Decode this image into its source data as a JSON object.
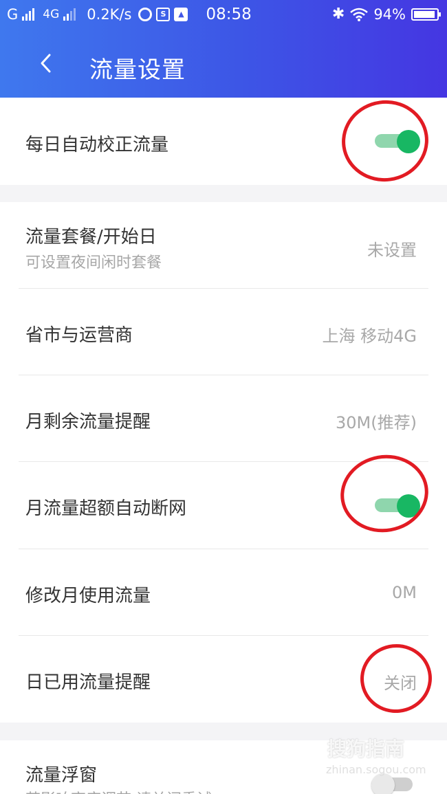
{
  "status_bar": {
    "carrier_g": "G",
    "network": "4G",
    "speed": "0.2K/s",
    "time": "08:58",
    "battery": "94%"
  },
  "header": {
    "title": "流量设置"
  },
  "settings": {
    "auto_calibrate": {
      "label": "每日自动校正流量",
      "enabled": true
    },
    "plan": {
      "label": "流量套餐/开始日",
      "sub": "可设置夜间闲时套餐",
      "value": "未设置"
    },
    "region": {
      "label": "省市与运营商",
      "value": "上海 移动4G"
    },
    "remaining_alert": {
      "label": "月剩余流量提醒",
      "value": "30M(推荐)"
    },
    "auto_disconnect": {
      "label": "月流量超额自动断网",
      "enabled": true
    },
    "monthly_usage": {
      "label": "修改月使用流量",
      "value": "0M"
    },
    "daily_alert": {
      "label": "日已用流量提醒",
      "value": "关闭"
    },
    "float_window": {
      "label": "流量浮窗",
      "sub": "若影响高度调节,请关闭重试",
      "enabled": false
    }
  },
  "watermark": {
    "text": "搜狗指南",
    "url": "zhinan.sogou.com"
  },
  "colors": {
    "header_start": "#3f78ee",
    "header_end": "#4536e2",
    "toggle_on": "#18b763",
    "annotation": "#e21b23"
  }
}
